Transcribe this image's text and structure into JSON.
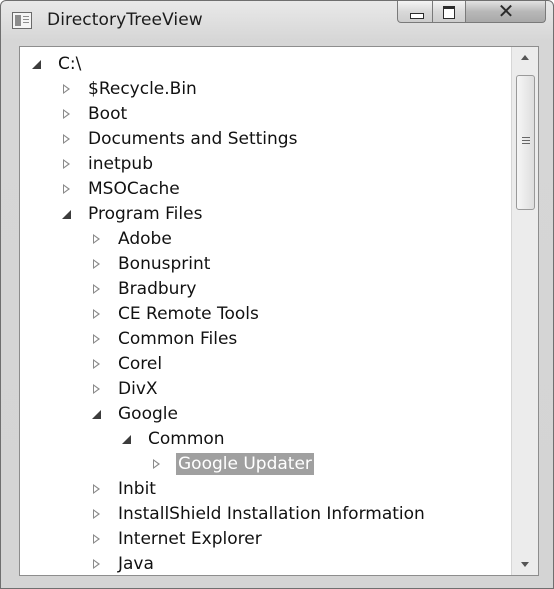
{
  "window": {
    "title": "DirectoryTreeView",
    "icon": "window-app-icon",
    "buttons": {
      "minimize": "minimize-icon",
      "maximize": "maximize-icon",
      "close": "close-icon"
    }
  },
  "tree": {
    "nodes": [
      {
        "label": "C:\\",
        "state": "expanded",
        "depth": 0
      },
      {
        "label": "$Recycle.Bin",
        "state": "collapsed",
        "depth": 1
      },
      {
        "label": "Boot",
        "state": "collapsed",
        "depth": 1
      },
      {
        "label": "Documents and Settings",
        "state": "collapsed",
        "depth": 1
      },
      {
        "label": "inetpub",
        "state": "collapsed",
        "depth": 1
      },
      {
        "label": "MSOCache",
        "state": "collapsed",
        "depth": 1
      },
      {
        "label": "Program Files",
        "state": "expanded",
        "depth": 1
      },
      {
        "label": "Adobe",
        "state": "collapsed",
        "depth": 2
      },
      {
        "label": "Bonusprint",
        "state": "collapsed",
        "depth": 2
      },
      {
        "label": "Bradbury",
        "state": "collapsed",
        "depth": 2
      },
      {
        "label": "CE Remote Tools",
        "state": "collapsed",
        "depth": 2
      },
      {
        "label": "Common Files",
        "state": "collapsed",
        "depth": 2
      },
      {
        "label": "Corel",
        "state": "collapsed",
        "depth": 2
      },
      {
        "label": "DivX",
        "state": "collapsed",
        "depth": 2
      },
      {
        "label": "Google",
        "state": "expanded",
        "depth": 2
      },
      {
        "label": "Common",
        "state": "expanded",
        "depth": 3
      },
      {
        "label": "Google Updater",
        "state": "collapsed",
        "depth": 4,
        "selected": true
      },
      {
        "label": "Inbit",
        "state": "collapsed",
        "depth": 2
      },
      {
        "label": "InstallShield Installation Information",
        "state": "collapsed",
        "depth": 2
      },
      {
        "label": "Internet Explorer",
        "state": "collapsed",
        "depth": 2
      },
      {
        "label": "Java",
        "state": "collapsed",
        "depth": 2
      }
    ]
  },
  "scrollbar": {
    "position_fraction": 0.0,
    "visible_fraction": 0.28
  },
  "colors": {
    "selection": "#a0a0a0",
    "selection_text": "#ffffff"
  }
}
